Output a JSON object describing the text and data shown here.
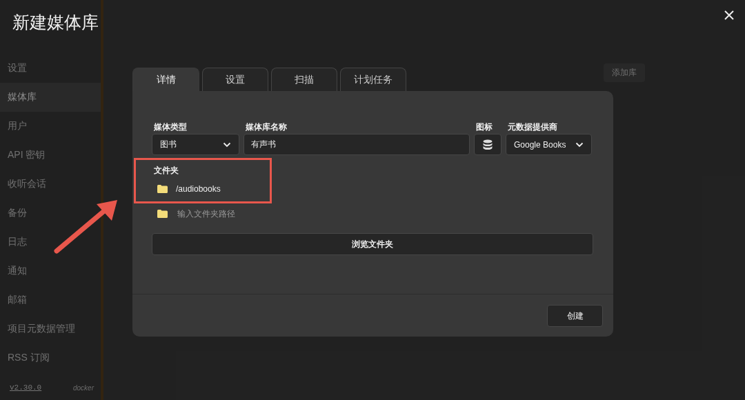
{
  "background": {
    "sidebar": {
      "items": [
        {
          "label": "设置",
          "selected": false
        },
        {
          "label": "媒体库",
          "selected": true
        },
        {
          "label": "用户",
          "selected": false
        },
        {
          "label": "API 密钥",
          "selected": false
        },
        {
          "label": "收听会话",
          "selected": false
        },
        {
          "label": "备份",
          "selected": false
        },
        {
          "label": "日志",
          "selected": false
        },
        {
          "label": "通知",
          "selected": false
        },
        {
          "label": "邮箱",
          "selected": false
        },
        {
          "label": "项目元数据管理",
          "selected": false
        },
        {
          "label": "RSS 订阅",
          "selected": false
        }
      ],
      "version": "v2.30.0",
      "build": "docker"
    },
    "add_button": "添加库"
  },
  "dialog": {
    "title": "新建媒体库",
    "tabs": [
      {
        "label": "详情",
        "selected": true
      },
      {
        "label": "设置",
        "selected": false
      },
      {
        "label": "扫描",
        "selected": false
      },
      {
        "label": "计划任务",
        "selected": false
      }
    ],
    "fields": {
      "media_type": {
        "label": "媒体类型",
        "value": "图书"
      },
      "name": {
        "label": "媒体库名称",
        "value": "有声书"
      },
      "icon": {
        "label": "图标"
      },
      "provider": {
        "label": "元数据提供商",
        "value": "Google Books"
      }
    },
    "folders": {
      "label": "文件夹",
      "items": [
        "/audiobooks"
      ],
      "new_folder": {
        "placeholder": "输入文件夹路径"
      },
      "browse_button": "浏览文件夹"
    },
    "create_button": "创建"
  }
}
